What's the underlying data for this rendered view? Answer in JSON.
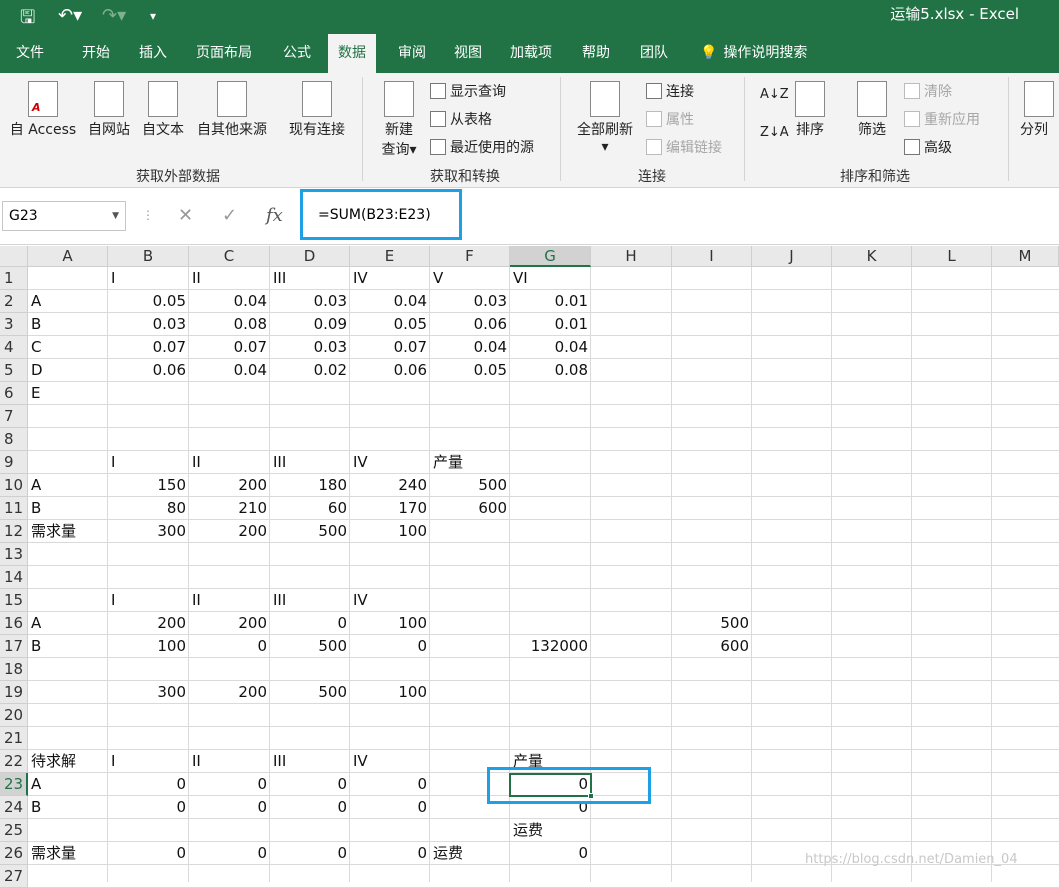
{
  "window": {
    "title": "运输5.xlsx  -  Excel"
  },
  "quick_access": {
    "save_icon": "save-icon",
    "undo_icon": "undo-icon",
    "redo_icon": "redo-icon",
    "customize_icon": "customize-icon"
  },
  "tabs": [
    "文件",
    "开始",
    "插入",
    "页面布局",
    "公式",
    "数据",
    "审阅",
    "视图",
    "加载项",
    "帮助",
    "团队",
    "操作说明搜索"
  ],
  "active_tab": "数据",
  "ribbon": {
    "get_external": {
      "group": "获取外部数据",
      "items": [
        "自 Access",
        "自网站",
        "自文本",
        "自其他来源",
        "现有连接"
      ]
    },
    "get_transform": {
      "group": "获取和转换",
      "new_query_1": "新建",
      "new_query_2": "查询",
      "show_query": "显示查询",
      "from_table": "从表格",
      "recent_sources": "最近使用的源"
    },
    "connections": {
      "group": "连接",
      "refresh_all": "全部刷新",
      "connections": "连接",
      "properties": "属性",
      "edit_links": "编辑链接"
    },
    "sort_filter": {
      "group": "排序和筛选",
      "sort": "排序",
      "filter": "筛选",
      "clear": "清除",
      "reapply": "重新应用",
      "advanced": "高级"
    },
    "data_tools": {
      "split": "分列"
    }
  },
  "formula_bar": {
    "name_box": "G23",
    "formula": "=SUM(B23:E23)"
  },
  "columns": [
    "A",
    "B",
    "C",
    "D",
    "E",
    "F",
    "G",
    "H",
    "I",
    "J",
    "K",
    "L",
    "M"
  ],
  "rows": [
    "1",
    "2",
    "3",
    "4",
    "5",
    "6",
    "7",
    "8",
    "9",
    "10",
    "11",
    "12",
    "13",
    "14",
    "15",
    "16",
    "17",
    "18",
    "19",
    "20",
    "21",
    "22",
    "23",
    "24",
    "25",
    "26",
    "27"
  ],
  "cells": {
    "B1": "I",
    "C1": "II",
    "D1": "III",
    "E1": "IV",
    "F1": "V",
    "G1": "VI",
    "A2": "A",
    "B2": "0.05",
    "C2": "0.04",
    "D2": "0.03",
    "E2": "0.04",
    "F2": "0.03",
    "G2": "0.01",
    "A3": "B",
    "B3": "0.03",
    "C3": "0.08",
    "D3": "0.09",
    "E3": "0.05",
    "F3": "0.06",
    "G3": "0.01",
    "A4": "C",
    "B4": "0.07",
    "C4": "0.07",
    "D4": "0.03",
    "E4": "0.07",
    "F4": "0.04",
    "G4": "0.04",
    "A5": "D",
    "B5": "0.06",
    "C5": "0.04",
    "D5": "0.02",
    "E5": "0.06",
    "F5": "0.05",
    "G5": "0.08",
    "A6": "E",
    "B9": "I",
    "C9": "II",
    "D9": "III",
    "E9": "IV",
    "F9": "产量",
    "A10": "A",
    "B10": "150",
    "C10": "200",
    "D10": "180",
    "E10": "240",
    "F10": "500",
    "A11": "B",
    "B11": "80",
    "C11": "210",
    "D11": "60",
    "E11": "170",
    "F11": "600",
    "A12": "需求量",
    "B12": "300",
    "C12": "200",
    "D12": "500",
    "E12": "100",
    "B15": "I",
    "C15": "II",
    "D15": "III",
    "E15": "IV",
    "A16": "A",
    "B16": "200",
    "C16": "200",
    "D16": "0",
    "E16": "100",
    "I16": "500",
    "A17": "B",
    "B17": "100",
    "C17": "0",
    "D17": "500",
    "E17": "0",
    "G17": "132000",
    "I17": "600",
    "B19": "300",
    "C19": "200",
    "D19": "500",
    "E19": "100",
    "A22": "待求解",
    "B22": "I",
    "C22": "II",
    "D22": "III",
    "E22": "IV",
    "G22": "产量",
    "A23": "A",
    "B23": "0",
    "C23": "0",
    "D23": "0",
    "E23": "0",
    "G23": "0",
    "A24": "B",
    "B24": "0",
    "C24": "0",
    "D24": "0",
    "E24": "0",
    "G24": "0",
    "G25": "运费",
    "A26": "需求量",
    "B26": "0",
    "C26": "0",
    "D26": "0",
    "E26": "0",
    "F26": "运费",
    "G26": "0"
  },
  "selected_cell": "G23",
  "watermark": "https://blog.csdn.net/Damien_04"
}
